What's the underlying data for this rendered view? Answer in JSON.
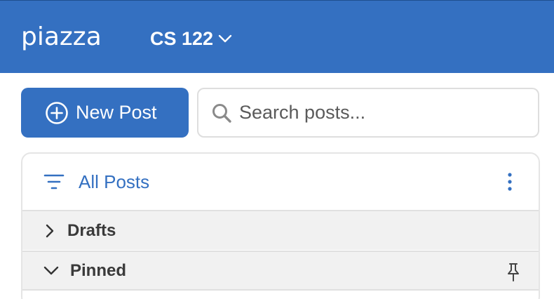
{
  "header": {
    "logo_text": "piazza",
    "course": "CS 122",
    "background_color": "#3470c1"
  },
  "toolbar": {
    "new_post_label": "New Post",
    "search_placeholder": "Search posts..."
  },
  "feed": {
    "filter_label": "All Posts",
    "sections": [
      {
        "label": "Drafts",
        "expanded": false
      },
      {
        "label": "Pinned",
        "expanded": true
      }
    ]
  },
  "icons": [
    "chevron-down-icon",
    "plus-circle-icon",
    "search-icon",
    "filter-icon",
    "kebab-icon",
    "chevron-right-icon",
    "pin-icon"
  ]
}
